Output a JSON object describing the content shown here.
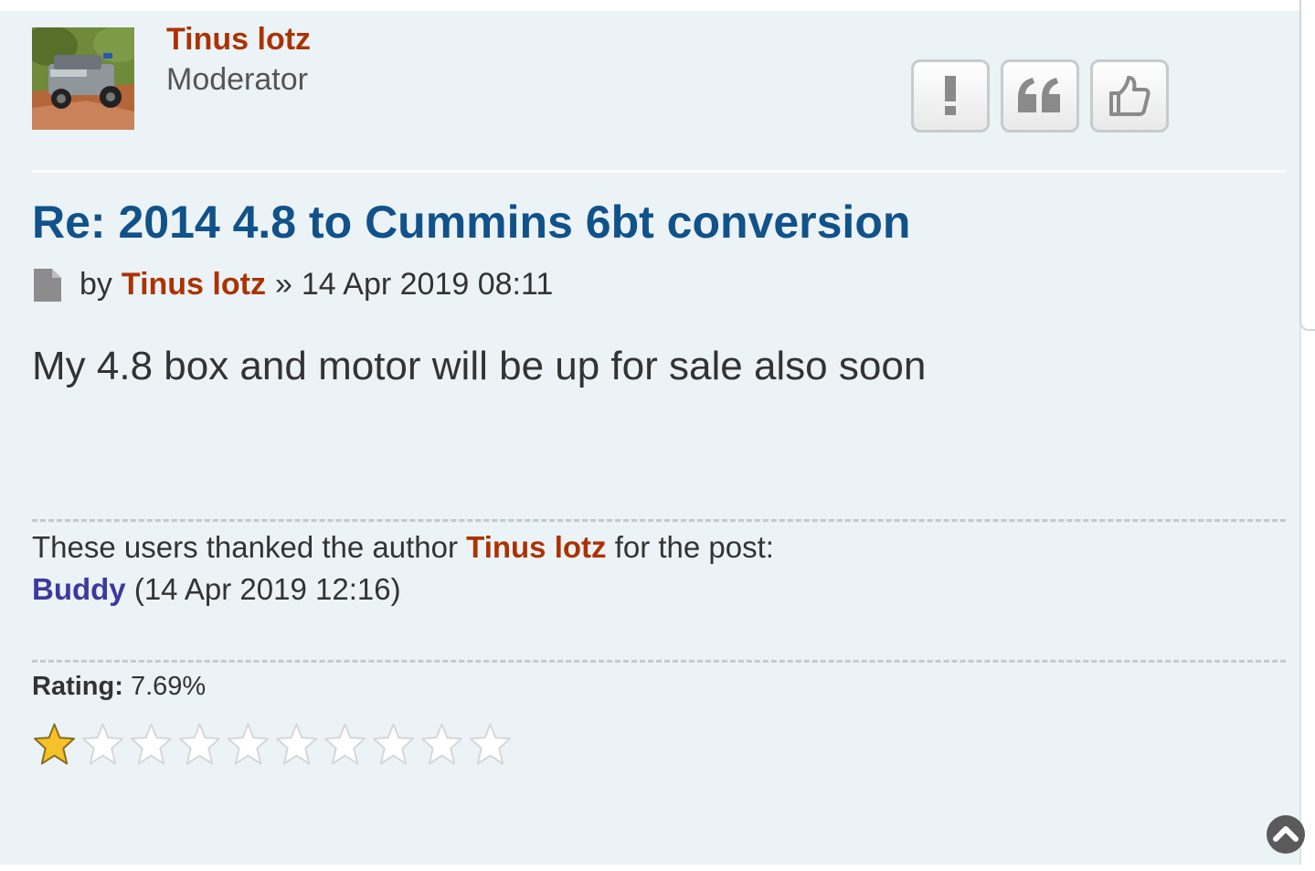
{
  "post": {
    "author": {
      "name": "Tinus lotz",
      "rank": "Moderator"
    },
    "actions": [
      {
        "label": "!",
        "icon": "report-icon"
      },
      {
        "label": "quote",
        "icon": "quote-icon"
      },
      {
        "label": "thanks",
        "icon": "thumbs-up-icon"
      }
    ],
    "title": "Re: 2014 4.8 to Cummins 6bt conversion",
    "meta": {
      "by": "by",
      "author": "Tinus lotz",
      "separator": "»",
      "date": "14 Apr 2019 08:11"
    },
    "content": "My 4.8 box and motor will be up for sale also soon"
  },
  "thanks": {
    "text_before": "These users thanked the author",
    "author": "Tinus lotz",
    "text_after": "for the post:",
    "users": [
      {
        "name": "Buddy",
        "date": "(14 Apr 2019 12:16)"
      }
    ]
  },
  "rating": {
    "label": "Rating:",
    "value": "7.69%",
    "stars_total": 10,
    "stars_filled": 1
  },
  "colors": {
    "author": "#aa3300",
    "title": "#105289",
    "thanked_user": "#3a3a9e",
    "background": "#ecf3f7"
  }
}
